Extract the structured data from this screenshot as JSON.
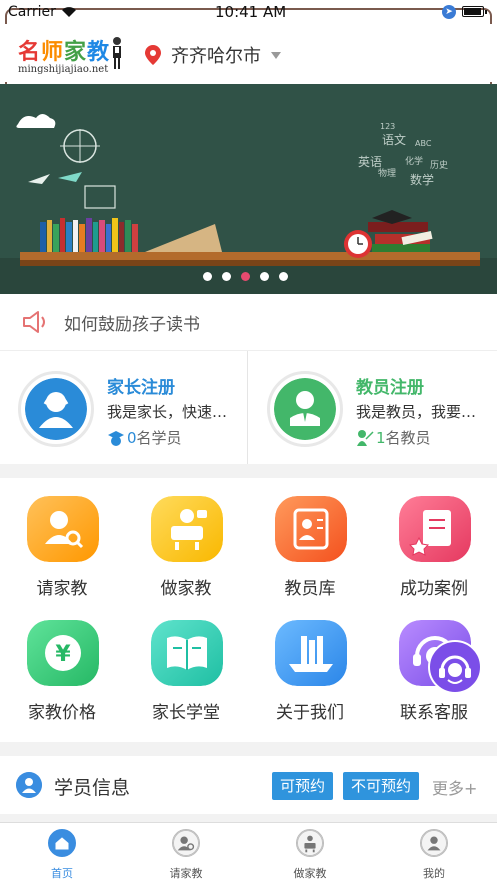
{
  "status_bar": {
    "carrier": "Carrier",
    "time": "10:41 AM"
  },
  "header": {
    "logo_chars": [
      "名",
      "师",
      "家",
      "教"
    ],
    "logo_domain": "mingshijiajiao.net",
    "city": "齐齐哈尔市"
  },
  "banner": {
    "board_words": [
      "语文",
      "英语",
      "化学",
      "物理",
      "历史",
      "数学",
      "ABC",
      "123"
    ],
    "slide_count": 5,
    "active_slide": 3
  },
  "notice": {
    "text": "如何鼓励孩子读书"
  },
  "registration": {
    "parent": {
      "title": "家长注册",
      "desc": "我是家长，快速…",
      "count": "0",
      "unit": "名学员",
      "color": "#2a8bd8"
    },
    "teacher": {
      "title": "教员注册",
      "desc": "我是教员，我要…",
      "count": "1",
      "unit": "名教员",
      "color": "#43b76a"
    }
  },
  "grid": {
    "items": [
      {
        "label": "请家教",
        "icon": "find-tutor-icon",
        "color_a": "#ffb74d",
        "color_b": "#ff9800"
      },
      {
        "label": "做家教",
        "icon": "be-tutor-icon",
        "color_a": "#ffd54f",
        "color_b": "#f9b800"
      },
      {
        "label": "教员库",
        "icon": "tutor-library-icon",
        "color_a": "#ff8a50",
        "color_b": "#f4511e"
      },
      {
        "label": "成功案例",
        "icon": "success-cases-icon",
        "color_a": "#ff6f8a",
        "color_b": "#e53960"
      },
      {
        "label": "家教价格",
        "icon": "tutor-price-icon",
        "color_a": "#4cd98a",
        "color_b": "#26b865"
      },
      {
        "label": "家长学堂",
        "icon": "parent-school-icon",
        "color_a": "#4ddbc2",
        "color_b": "#1fbfa3"
      },
      {
        "label": "关于我们",
        "icon": "about-us-icon",
        "color_a": "#5fb2ff",
        "color_b": "#2b86e8"
      },
      {
        "label": "联系客服",
        "icon": "customer-service-icon",
        "color_a": "#b07cff",
        "color_b": "#7b4ee8"
      }
    ]
  },
  "students": {
    "title": "学员信息",
    "bookable": "可预约",
    "not_bookable": "不可预约",
    "more": "更多+"
  },
  "tabbar": {
    "items": [
      {
        "label": "首页",
        "icon": "home-icon",
        "active": true
      },
      {
        "label": "请家教",
        "icon": "find-tutor-tab-icon",
        "active": false
      },
      {
        "label": "做家教",
        "icon": "be-tutor-tab-icon",
        "active": false
      },
      {
        "label": "我的",
        "icon": "profile-icon",
        "active": false
      }
    ]
  },
  "colors": {
    "accent": "#2f94dd",
    "board": "#2f4f44",
    "active_dot": "#e64a6f"
  }
}
